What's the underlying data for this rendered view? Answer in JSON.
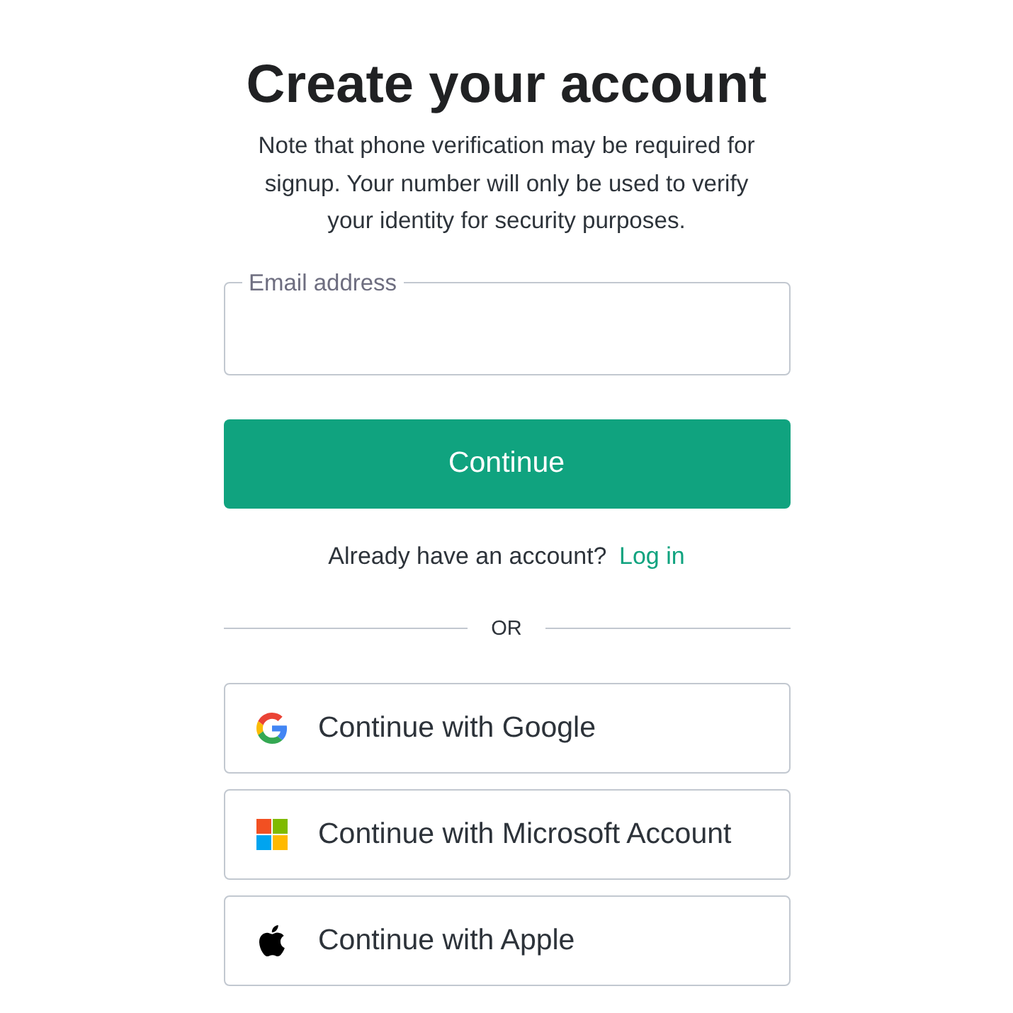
{
  "title": "Create your account",
  "note": "Note that phone verification may be required for signup. Your number will only be used to verify your identity for security purposes.",
  "email_field": {
    "label": "Email address"
  },
  "continue_button": "Continue",
  "login_prompt": {
    "text": "Already have an account?",
    "link": "Log in"
  },
  "divider": "OR",
  "social_buttons": [
    {
      "kind": "google",
      "label": "Continue with Google"
    },
    {
      "kind": "microsoft",
      "label": "Continue with Microsoft Account"
    },
    {
      "kind": "apple",
      "label": "Continue with Apple"
    }
  ]
}
